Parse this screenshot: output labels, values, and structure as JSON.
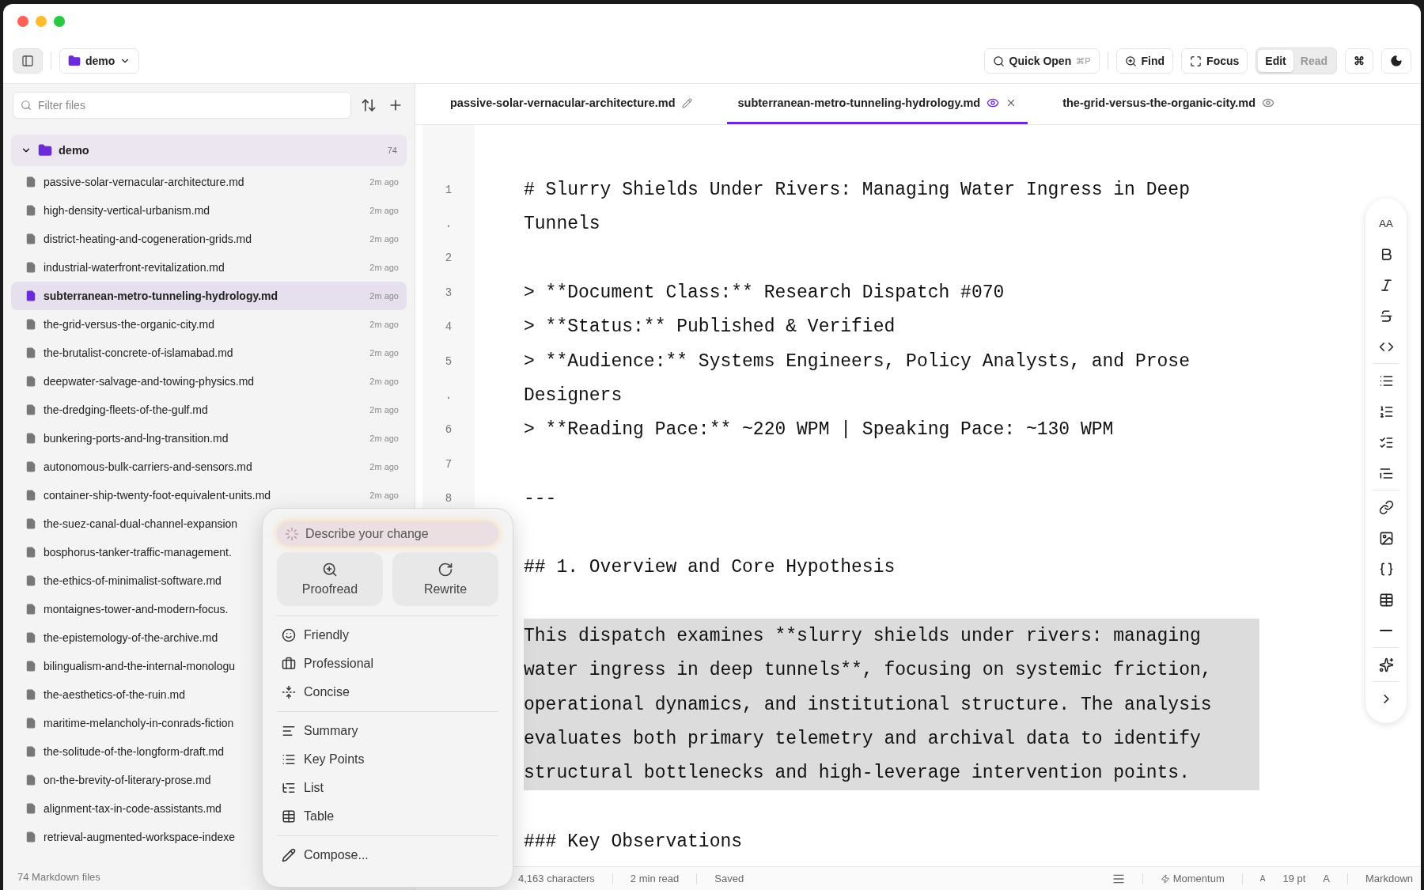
{
  "toolbar": {
    "folder": "demo",
    "quick_open": {
      "label": "Quick Open",
      "shortcut": "⌘P"
    },
    "find": "Find",
    "focus": "Focus",
    "modes": [
      {
        "label": "Edit",
        "selected": true
      },
      {
        "label": "Read",
        "selected": false
      }
    ],
    "command_key": "⌘"
  },
  "sidebar": {
    "filter_placeholder": "Filter files",
    "folder": {
      "name": "demo",
      "count": "74",
      "expanded": true
    },
    "files": [
      {
        "name": "passive-solar-vernacular-architecture.md",
        "time": "2m ago",
        "selected": false
      },
      {
        "name": "high-density-vertical-urbanism.md",
        "time": "2m ago",
        "selected": false
      },
      {
        "name": "district-heating-and-cogeneration-grids.md",
        "time": "2m ago",
        "selected": false
      },
      {
        "name": "industrial-waterfront-revitalization.md",
        "time": "2m ago",
        "selected": false
      },
      {
        "name": "subterranean-metro-tunneling-hydrology.md",
        "time": "2m ago",
        "selected": true
      },
      {
        "name": "the-grid-versus-the-organic-city.md",
        "time": "2m ago",
        "selected": false
      },
      {
        "name": "the-brutalist-concrete-of-islamabad.md",
        "time": "2m ago",
        "selected": false
      },
      {
        "name": "deepwater-salvage-and-towing-physics.md",
        "time": "2m ago",
        "selected": false
      },
      {
        "name": "the-dredging-fleets-of-the-gulf.md",
        "time": "2m ago",
        "selected": false
      },
      {
        "name": "bunkering-ports-and-lng-transition.md",
        "time": "2m ago",
        "selected": false
      },
      {
        "name": "autonomous-bulk-carriers-and-sensors.md",
        "time": "2m ago",
        "selected": false
      },
      {
        "name": "container-ship-twenty-foot-equivalent-units.md",
        "time": "2m ago",
        "selected": false
      },
      {
        "name": "the-suez-canal-dual-channel-expansion",
        "selected": false
      },
      {
        "name": "bosphorus-tanker-traffic-management.",
        "selected": false
      },
      {
        "name": "the-ethics-of-minimalist-software.md",
        "selected": false
      },
      {
        "name": "montaignes-tower-and-modern-focus.",
        "selected": false
      },
      {
        "name": "the-epistemology-of-the-archive.md",
        "selected": false
      },
      {
        "name": "bilingualism-and-the-internal-monologu",
        "selected": false
      },
      {
        "name": "the-aesthetics-of-the-ruin.md",
        "selected": false
      },
      {
        "name": "maritime-melancholy-in-conrads-fiction",
        "selected": false
      },
      {
        "name": "the-solitude-of-the-longform-draft.md",
        "selected": false
      },
      {
        "name": "on-the-brevity-of-literary-prose.md",
        "selected": false
      },
      {
        "name": "alignment-tax-in-code-assistants.md",
        "selected": false
      },
      {
        "name": "retrieval-augmented-workspace-indexe",
        "selected": false
      }
    ],
    "footer": "74 Markdown files"
  },
  "tabs": [
    {
      "label": "passive-solar-vernacular-architecture.md",
      "selected": false,
      "kind": "edited"
    },
    {
      "label": "subterranean-metro-tunneling-hydrology.md",
      "selected": true,
      "kind": "preview"
    },
    {
      "label": "the-grid-versus-the-organic-city.md",
      "selected": false,
      "kind": "preview"
    }
  ],
  "editor": {
    "lines": [
      {
        "number": "1",
        "text": "# Slurry Shields Under Rivers: Managing Water Ingress in Deep",
        "selected": false
      },
      {
        "number": ".",
        "text": "Tunnels",
        "selected": false
      },
      {
        "number": "2",
        "selected": false
      },
      {
        "number": "3",
        "text": "> **Document Class:** Research Dispatch #070",
        "selected": false
      },
      {
        "number": "4",
        "text": "> **Status:** Published & Verified",
        "selected": false
      },
      {
        "number": "5",
        "text": "> **Audience:** Systems Engineers, Policy Analysts, and Prose",
        "selected": false
      },
      {
        "number": ".",
        "text": "Designers",
        "selected": false
      },
      {
        "number": "6",
        "text": "> **Reading Pace:** ~220 WPM | Speaking Pace: ~130 WPM",
        "selected": false
      },
      {
        "number": "7",
        "selected": false
      },
      {
        "number": "8",
        "text": "---",
        "selected": false
      },
      {
        "selected": false
      },
      {
        "text": "## 1. Overview and Core Hypothesis",
        "selected": false
      },
      {
        "selected": false
      },
      {
        "text": "This dispatch examines **slurry shields under rivers: managing",
        "selected": true
      },
      {
        "text": "water ingress in deep tunnels**, focusing on systemic friction,",
        "selected": true
      },
      {
        "text": "operational dynamics, and institutional structure. The analysis",
        "selected": true
      },
      {
        "text": "evaluates both primary telemetry and archival data to identify",
        "selected": true
      },
      {
        "text": "structural bottlenecks and high-leverage intervention points.",
        "selected": true
      },
      {
        "selected": false
      },
      {
        "text": "### Key Observations",
        "selected": false
      }
    ]
  },
  "format_toolbar": [
    [
      {
        "kind": "text",
        "label": "AA"
      },
      {
        "kind": "bold"
      },
      {
        "kind": "italic"
      },
      {
        "kind": "strike"
      },
      {
        "kind": "code"
      }
    ],
    [
      {
        "kind": "bullets"
      },
      {
        "kind": "numbers"
      },
      {
        "kind": "tasks"
      },
      {
        "kind": "quote"
      }
    ],
    [
      {
        "kind": "link"
      },
      {
        "kind": "image"
      },
      {
        "kind": "braces"
      },
      {
        "kind": "table"
      },
      {
        "kind": "rule"
      }
    ],
    [
      {
        "kind": "sparkle"
      }
    ],
    [
      {
        "kind": "chevron"
      }
    ]
  ],
  "ai_popup": {
    "placeholder": "Describe your change",
    "actions": [
      {
        "label": "Proofread",
        "kind": "proofread"
      },
      {
        "label": "Rewrite",
        "kind": "rewrite"
      }
    ],
    "sections": [
      [
        {
          "label": "Friendly",
          "kind": "friendly"
        },
        {
          "label": "Professional",
          "kind": "professional"
        },
        {
          "label": "Concise",
          "kind": "concise"
        }
      ],
      [
        {
          "label": "Summary",
          "kind": "summary"
        },
        {
          "label": "Key Points",
          "kind": "keypoints"
        },
        {
          "label": "List",
          "kind": "list"
        },
        {
          "label": "Table",
          "kind": "table"
        }
      ],
      [
        {
          "label": "Compose...",
          "kind": "compose"
        }
      ]
    ]
  },
  "status_bar": {
    "characters": "4,163 characters",
    "read_time": "2 min read",
    "save_state": "Saved",
    "theme": "Momentum",
    "font_small": "A",
    "font_size": "19 pt",
    "font_large": "A",
    "mode": "Markdown"
  }
}
